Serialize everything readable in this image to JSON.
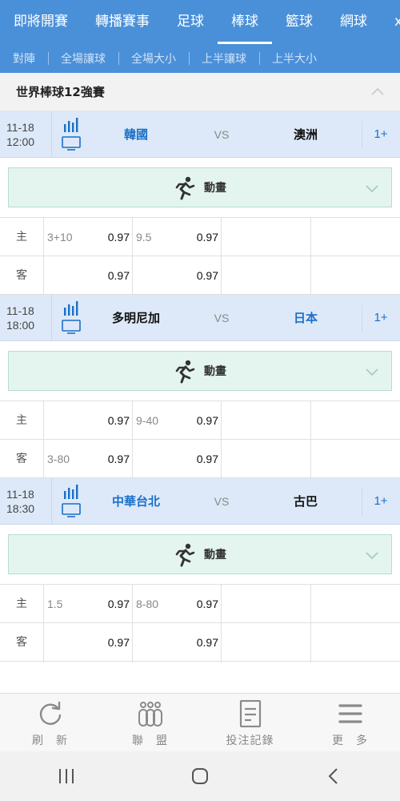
{
  "top_tabs": [
    "即將開賽",
    "轉播賽事",
    "足球",
    "棒球",
    "籃球",
    "網球",
    "x"
  ],
  "active_top_tab": "棒球",
  "sub_tabs": [
    "對陣",
    "全場讓球",
    "全場大小",
    "上半讓球",
    "上半大小"
  ],
  "section": {
    "title": "世界棒球12強賽"
  },
  "animation_label": "動畫",
  "vs_label": "VS",
  "side_labels": {
    "home": "主",
    "away": "客"
  },
  "matches": [
    {
      "date": "11-18",
      "time": "12:00",
      "home": "韓國",
      "away": "澳洲",
      "more": "1+",
      "rows": [
        {
          "hcap1": "3+10",
          "odds1": "0.97",
          "hcap2": "9.5",
          "odds2": "0.97"
        },
        {
          "hcap1": "",
          "odds1": "0.97",
          "hcap2": "",
          "odds2": "0.97"
        }
      ]
    },
    {
      "date": "11-18",
      "time": "18:00",
      "home": "多明尼加",
      "away": "日本",
      "more": "1+",
      "rows": [
        {
          "hcap1": "",
          "odds1": "0.97",
          "hcap2": "9-40",
          "odds2": "0.97"
        },
        {
          "hcap1": "3-80",
          "odds1": "0.97",
          "hcap2": "",
          "odds2": "0.97"
        }
      ]
    },
    {
      "date": "11-18",
      "time": "18:30",
      "home": "中華台北",
      "away": "古巴",
      "more": "1+",
      "rows": [
        {
          "hcap1": "1.5",
          "odds1": "0.97",
          "hcap2": "8-80",
          "odds2": "0.97"
        },
        {
          "hcap1": "",
          "odds1": "0.97",
          "hcap2": "",
          "odds2": "0.97"
        }
      ]
    }
  ],
  "bottom_nav": [
    {
      "label": "刷　新",
      "icon": "refresh-icon"
    },
    {
      "label": "聯　盟",
      "icon": "league-icon"
    },
    {
      "label": "投注記錄",
      "icon": "bet-record-icon"
    },
    {
      "label": "更　多",
      "icon": "menu-icon"
    }
  ],
  "colors": {
    "header_blue": "#4a90d9",
    "match_bg": "#dde9f8",
    "team_blue": "#1a6fc9",
    "anim_bg": "#e3f5ee"
  }
}
